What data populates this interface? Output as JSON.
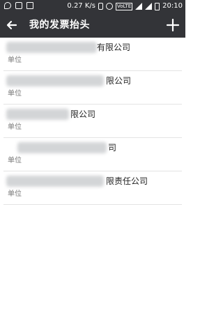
{
  "status_bar": {
    "speed": "0.27 K/s",
    "network_badge": "VoLTE",
    "time": "20:10"
  },
  "header": {
    "title": "我的发票抬头"
  },
  "invoice_titles": [
    {
      "name_visible": "有限公司",
      "type": "单位"
    },
    {
      "name_visible": "限公司",
      "type": "单位"
    },
    {
      "name_visible": "限公司",
      "type": "单位"
    },
    {
      "name_visible": "司",
      "type": "单位"
    },
    {
      "name_visible": "限责任公司",
      "type": "单位"
    }
  ]
}
